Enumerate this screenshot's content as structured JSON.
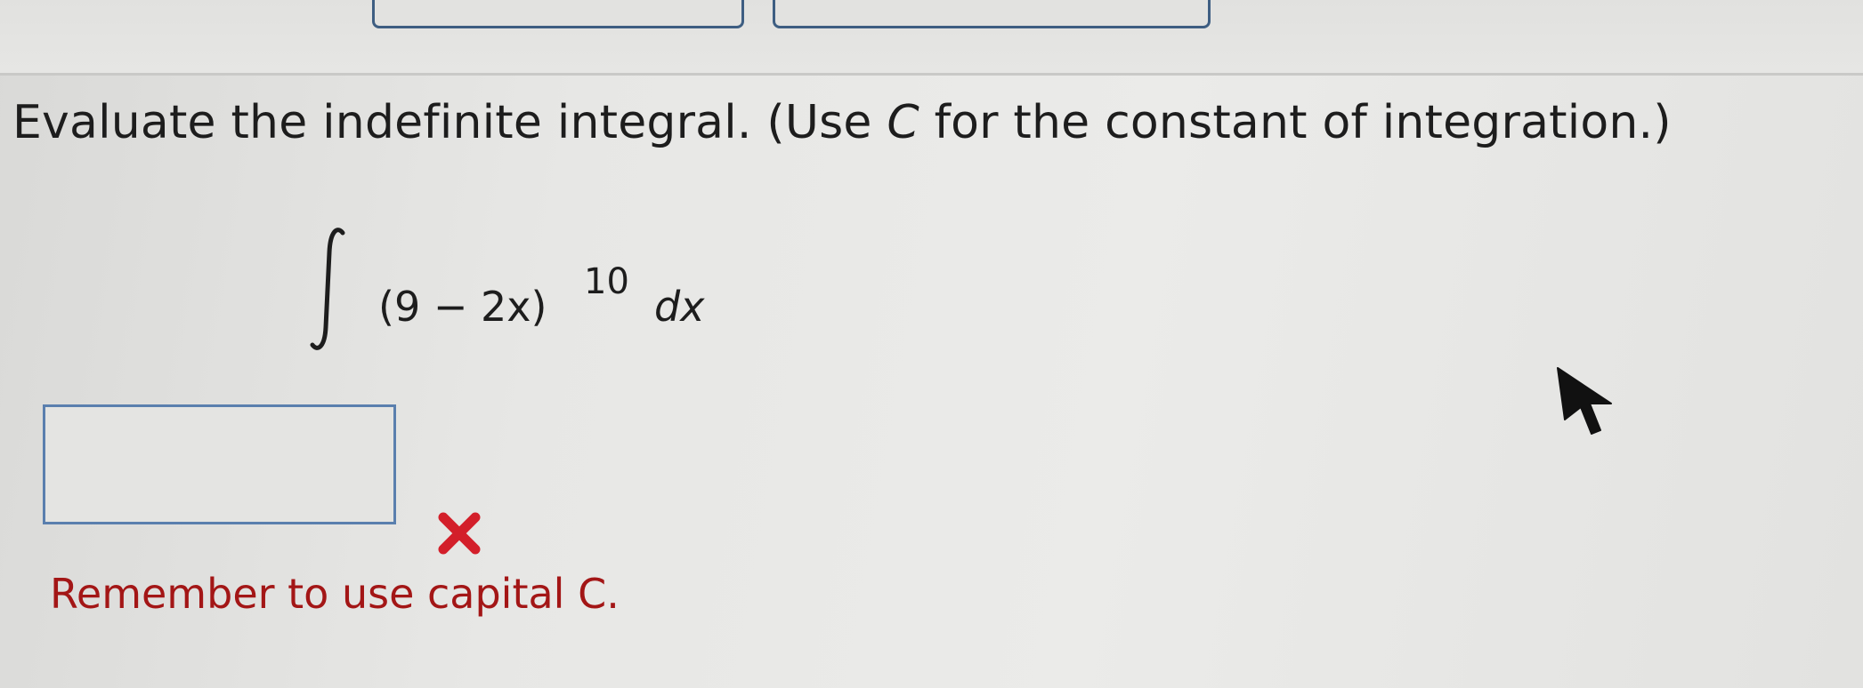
{
  "question": {
    "instruction_before": "Evaluate the indefinite integral. (Use ",
    "instruction_var": "C",
    "instruction_after": " for the constant of integration.)",
    "integral_symbol": "∫",
    "integrand": "(9 − 2x)",
    "exponent": "10",
    "differential": "dx"
  },
  "answer": {
    "value": "",
    "status": "incorrect",
    "status_icon": "x-mark-icon",
    "status_color": "#d31f2a"
  },
  "feedback": {
    "message": "Remember to use capital C.",
    "color": "#a31616"
  },
  "top_buttons": [
    "",
    ""
  ],
  "colors": {
    "button_border": "#3e5e82",
    "input_border": "#5a7fae"
  }
}
